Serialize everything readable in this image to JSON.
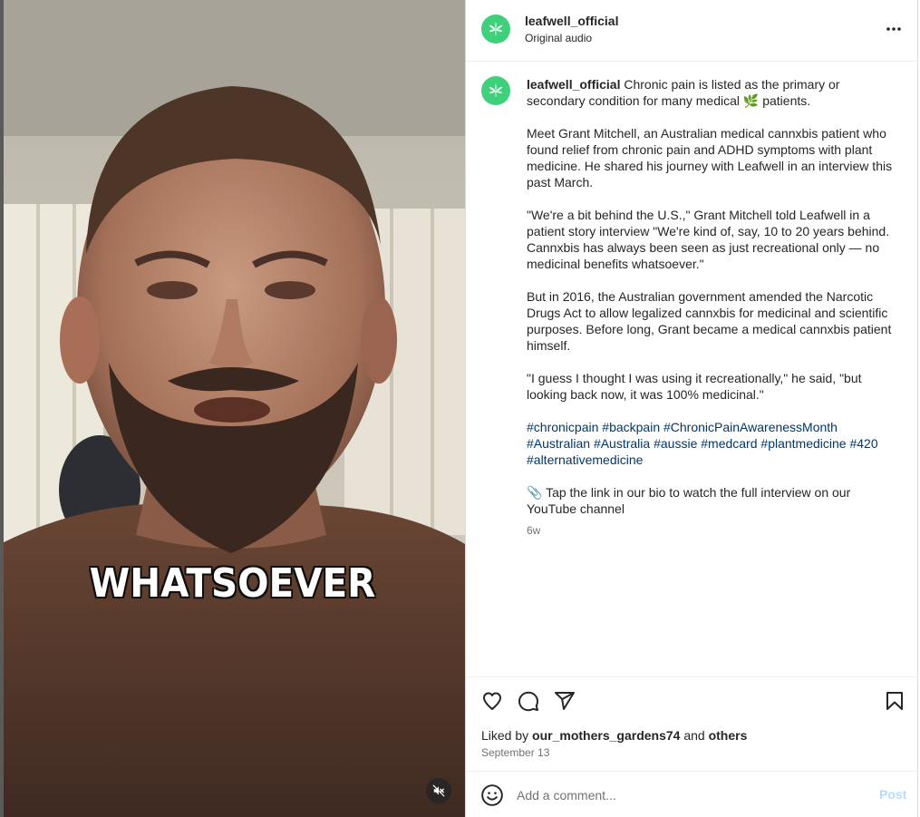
{
  "video": {
    "caption_text": "WHATSOEVER",
    "mute_icon": "speaker-muted-icon"
  },
  "post": {
    "username": "leafwell_official",
    "audio": "Original audio",
    "more_icon": "more-horizontal-icon",
    "avatar_icon": "cannabis-leaf-icon",
    "brand_color": "#3ed07a"
  },
  "caption": {
    "username": "leafwell_official",
    "intro": "Chronic pain is listed as the primary or secondary condition for many medical 🌿 patients.",
    "paragraphs": [
      "Meet Grant Mitchell, an Australian medical cannxbis patient who found relief from chronic pain and ADHD symptoms with plant medicine. He shared his journey with Leafwell in an interview this past March.",
      "\"We're a bit behind the U.S.,\" Grant Mitchell told Leafwell in a patient story interview \"We're kind of, say, 10 to 20 years behind. Cannxbis has always been seen as just recreational only — no medicinal benefits whatsoever.\"",
      "But in 2016, the Australian government amended the Narcotic Drugs Act to allow legalized cannxbis for medicinal and scientific purposes. Before long, Grant became a medical cannxbis patient himself.",
      "\"I guess I thought I was using it recreationally,\" he said, \"but looking back now, it was 100% medicinal.\""
    ],
    "hashtags": [
      "#chronicpain",
      "#backpain",
      "#ChronicPainAwarenessMonth",
      "#Australian",
      "#Australia",
      "#aussie",
      "#medcard",
      "#plantmedicine",
      "#420",
      "#alternativemedicine"
    ],
    "link_line": "📎 Tap the link in our bio to watch the full interview on our YouTube channel",
    "age": "6w"
  },
  "actions": {
    "like_icon": "heart-icon",
    "comment_icon": "comment-icon",
    "share_icon": "send-icon",
    "save_icon": "bookmark-icon",
    "liked_prefix": "Liked by",
    "liked_user": "our_mothers_gardens74",
    "liked_and": "and",
    "liked_others": "others",
    "date": "September 13"
  },
  "comment_box": {
    "emoji_icon": "emoji-icon",
    "placeholder": "Add a comment...",
    "post_label": "Post"
  }
}
